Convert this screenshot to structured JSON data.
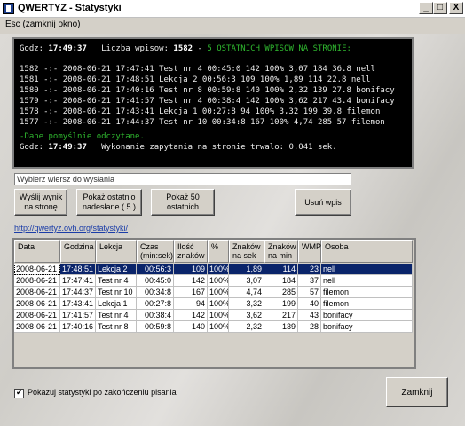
{
  "window": {
    "title": "QWERTYZ - Statystyki",
    "buttons": [
      "_",
      "□",
      "X"
    ]
  },
  "menu": {
    "escape": "Esc (zamknij okno)"
  },
  "console": {
    "header_time_label": "Godz:",
    "header_time": "17:49:37",
    "header_count_label": "Liczba wpisow:",
    "header_count": "1582",
    "header_sep": "-",
    "header_note": "5 OSTATNICH WPISOW NA STRONIE:",
    "lines": [
      "1582 -:- 2008-06-21 17:47:41 Test nr 4 00:45:0 142 100% 3,07 184 36.8 nell",
      "1581 -:- 2008-06-21 17:48:51 Lekcja 2 00:56:3 109 100% 1,89 114 22.8 nell",
      "1580 -:- 2008-06-21 17:40:16 Test nr 8 00:59:8 140 100% 2,32 139 27.8 bonifacy",
      "1579 -:- 2008-06-21 17:41:57 Test nr 4 00:38:4 142 100% 3,62 217 43.4 bonifacy",
      "1578 -:- 2008-06-21 17:43:41 Lekcja 1 00:27:8 94 100% 3,32 199 39.8 filemon",
      "1577 -:- 2008-06-21 17:44:37 Test nr 10 00:34:8 167 100% 4,74 285 57 filemon"
    ],
    "status_line": "-Dane pomyślnie odczytane.",
    "footer_time_label": "Godz:",
    "footer_time": "17:49:37",
    "footer_text": "Wykonanie zapytania na stronie trwalo: 0.041 sek."
  },
  "pick_row": "Wybierz wiersz do wysłania",
  "buttons": {
    "send_selected": "Wyślij wynik\nna stronę",
    "show_last_sent": "Pokaż ostatnio\nnadesłane ( 5 )",
    "show_50": "Pokaż 50\nostatnich",
    "delete": "Usuń  wpis",
    "close": "Zamknij"
  },
  "link": "http://qwertyz.ovh.org/statystyki/",
  "table": {
    "headers": [
      "Data",
      "Godzina",
      "Lekcja",
      "Czas\n(min:sek)",
      "Ilość\nznaków",
      "%",
      "Znaków\nna sek",
      "Znaków\nna min",
      "WMP",
      "Osoba"
    ],
    "rows": [
      [
        "2008-06-21",
        "17:48:51",
        "Lekcja 2",
        "00:56:3",
        "109",
        "100%",
        "1,89",
        "114",
        "23",
        "nell"
      ],
      [
        "2008-06-21",
        "17:47:41",
        "Test nr 4",
        "00:45:0",
        "142",
        "100%",
        "3,07",
        "184",
        "37",
        "nell"
      ],
      [
        "2008-06-21",
        "17:44:37",
        "Test nr 10",
        "00:34:8",
        "167",
        "100%",
        "4,74",
        "285",
        "57",
        "filemon"
      ],
      [
        "2008-06-21",
        "17:43:41",
        "Lekcja 1",
        "00:27:8",
        "94",
        "100%",
        "3,32",
        "199",
        "40",
        "filemon"
      ],
      [
        "2008-06-21",
        "17:41:57",
        "Test nr 4",
        "00:38:4",
        "142",
        "100%",
        "3,62",
        "217",
        "43",
        "bonifacy"
      ],
      [
        "2008-06-21",
        "17:40:16",
        "Test nr 8",
        "00:59:8",
        "140",
        "100%",
        "2,32",
        "139",
        "28",
        "bonifacy"
      ]
    ]
  },
  "checkbox": {
    "label": "Pokazuj statystyki po zakończeniu pisania",
    "checked": true
  }
}
